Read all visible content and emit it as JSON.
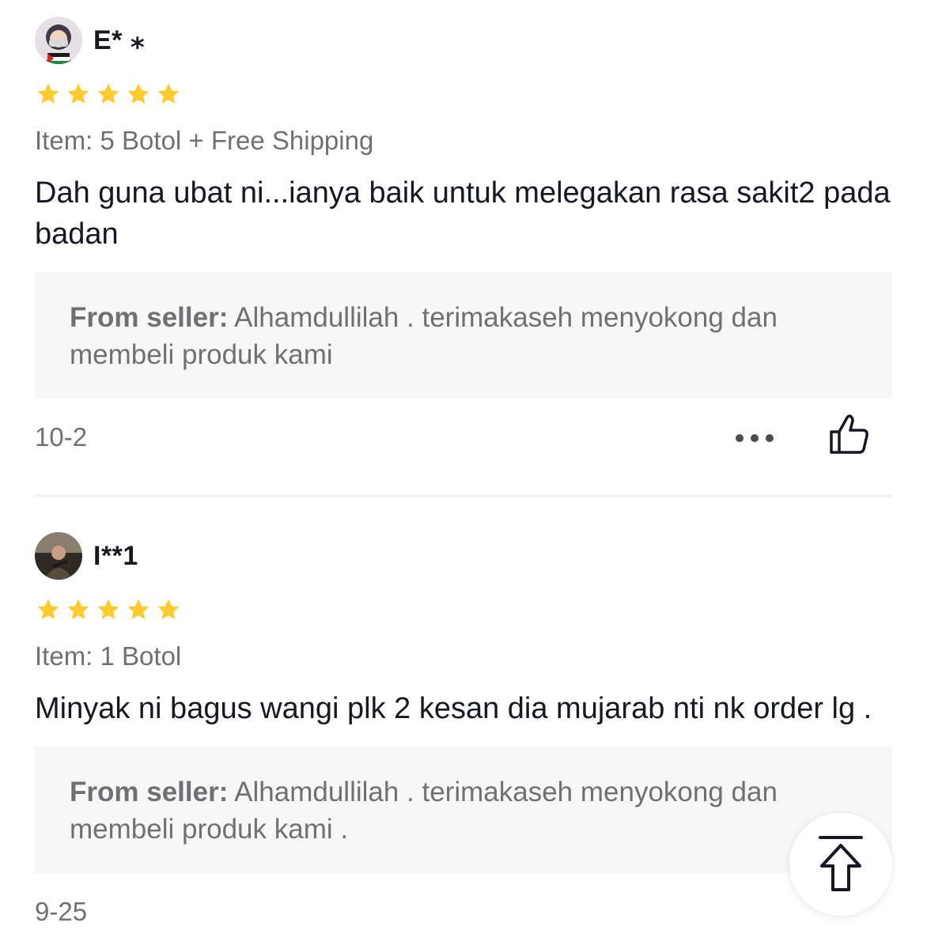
{
  "reviews": [
    {
      "username": "E* ⁎",
      "rating": 5,
      "item": "Item: 5 Botol + Free Shipping",
      "text": "Dah guna ubat ni...ianya baik untuk melegakan rasa sakit2 pada badan",
      "seller_label": "From seller:",
      "seller_reply": " Alhamdullilah . terimakaseh menyokong dan membeli produk kami",
      "date": "10-2"
    },
    {
      "username": "I**1",
      "rating": 5,
      "item": "Item: 1 Botol",
      "text": "Minyak ni bagus wangi plk 2 kesan dia mujarab nti nk order lg .",
      "seller_label": "From seller:",
      "seller_reply": " Alhamdullilah . terimakaseh menyokong dan membeli produk kami .",
      "date": "9-25"
    }
  ],
  "icons": {
    "star": "star-icon",
    "more": "more-icon",
    "like": "thumbs-up-icon",
    "back_to_top": "back-to-top-icon"
  },
  "colors": {
    "star": "#fecb2f",
    "text": "#161823",
    "muted": "#6f7073",
    "seller_bg": "#f7f7f8"
  }
}
